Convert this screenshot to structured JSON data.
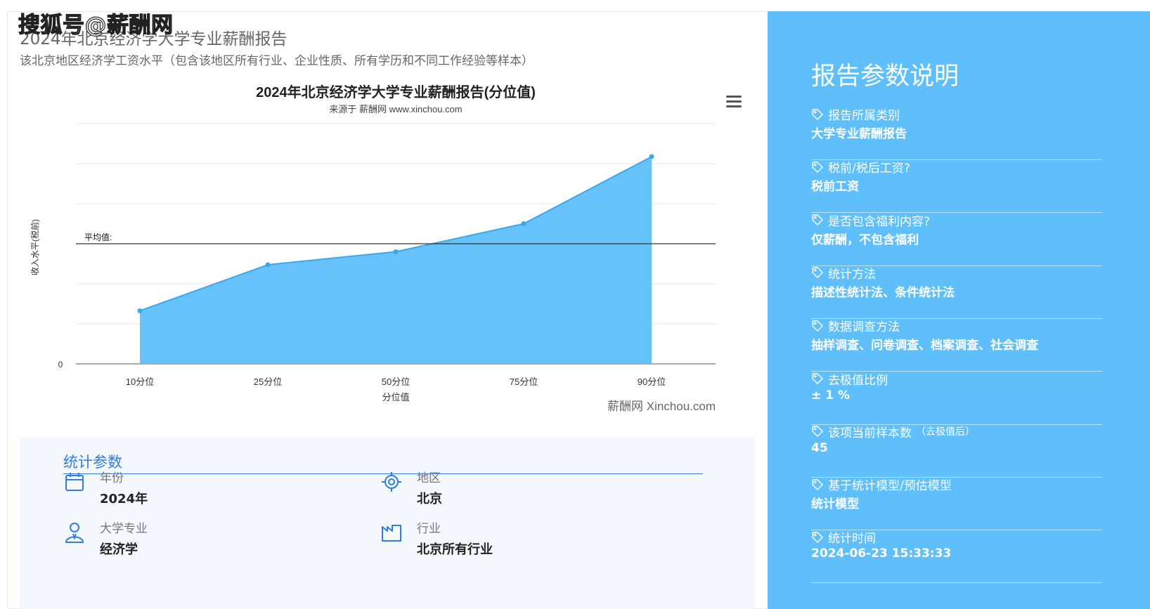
{
  "watermark": "搜狐号@薪酬网",
  "report": {
    "title": "2024年北京经济学大学专业薪酬报告",
    "subtitle": "该北京地区经济学工资水平（包含该地区所有行业、企业性质、所有学历和不同工作经验等样本）"
  },
  "chart_data": {
    "type": "area",
    "title": "2024年北京经济学大学专业薪酬报告(分位值)",
    "subtitle": "来源于 薪酬网 www.xinchou.com",
    "xlabel": "分位值",
    "ylabel": "收入水平(税前)",
    "categories": [
      "10分位",
      "25分位",
      "50分位",
      "75分位",
      "90分位"
    ],
    "values": [
      2650,
      4950,
      5600,
      7000,
      10350
    ],
    "ylim": [
      0,
      12000
    ],
    "y_tick_labels": [
      "0"
    ],
    "average_label": "平均值:",
    "average_value": 6000,
    "credit": "薪酬网 Xinchou.com",
    "color": "#5fbffb",
    "grid": true
  },
  "stats": {
    "heading": "统计参数",
    "items": [
      {
        "label": "年份",
        "value": "2024年",
        "icon": "calendar-icon"
      },
      {
        "label": "地区",
        "value": "北京",
        "icon": "location-target-icon"
      },
      {
        "label": "大学专业",
        "value": "经济学",
        "icon": "person-icon"
      },
      {
        "label": "行业",
        "value": "北京所有行业",
        "icon": "factory-icon"
      }
    ]
  },
  "side": {
    "title": "报告参数说明",
    "params": [
      {
        "label": "报告所属类别",
        "value": "大学专业薪酬报告"
      },
      {
        "label": "税前/税后工资?",
        "value": "税前工资"
      },
      {
        "label": "是否包含福利内容?",
        "value": "仅薪酬，不包含福利"
      },
      {
        "label": "统计方法",
        "value": "描述性统计法、条件统计法"
      },
      {
        "label": "数据调查方法",
        "value": "抽样调查、问卷调查、档案调查、社会调查"
      },
      {
        "label": "去极值比例",
        "value": "± 1 %"
      },
      {
        "label": "该项当前样本数",
        "label_note": "（去极值后）",
        "value": "45"
      },
      {
        "label": "基于统计模型/预估模型",
        "value": "统计模型"
      },
      {
        "label": "统计时间",
        "value": "2024-06-23 15:33:33"
      }
    ]
  },
  "colors": {
    "accent": "#2f7de1",
    "side_bg": "#5fbffb",
    "area": "#5fbffb",
    "stats_bg": "#f4f7fb"
  }
}
